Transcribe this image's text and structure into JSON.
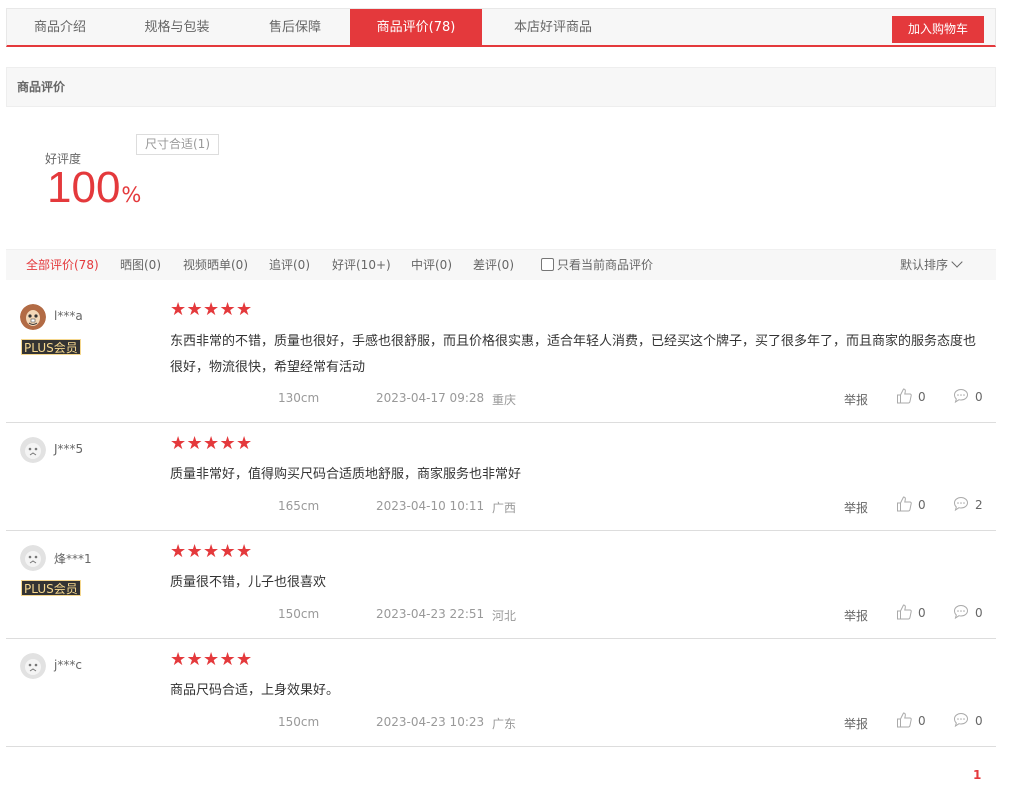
{
  "tabs": [
    {
      "label": "商品介绍"
    },
    {
      "label": "规格与包装"
    },
    {
      "label": "售后保障"
    },
    {
      "label": "商品评价(78)"
    },
    {
      "label": "本店好评商品"
    }
  ],
  "cart_button": "加入购物车",
  "section_title": "商品评价",
  "rating": {
    "label": "好评度",
    "value": "100",
    "unit": "%",
    "tag": "尺寸合适(1)"
  },
  "filters": [
    {
      "label": "全部评价(78)"
    },
    {
      "label": "晒图(0)"
    },
    {
      "label": "视频晒单(0)"
    },
    {
      "label": "追评(0)"
    },
    {
      "label": "好评(10+)"
    },
    {
      "label": "中评(0)"
    },
    {
      "label": "差评(0)"
    }
  ],
  "only_current_label": "只看当前商品评价",
  "sort_label": "默认排序",
  "report_label": "举报",
  "plus_label": "PLUS会员",
  "reviews": [
    {
      "user": "l***a",
      "content": "东西非常的不错，质量也很好，手感也很舒服，而且价格很实惠，适合年轻人消费，已经买这个牌子，买了很多年了，而且商家的服务态度也很好，物流很快，希望经常有活动",
      "size": "130cm",
      "time": "2023-04-17 09:28",
      "location": "重庆",
      "likes": "0",
      "comments": "0",
      "stars": 5,
      "plus": true
    },
    {
      "user": "J***5",
      "content": "质量非常好，值得购买尺码合适质地舒服，商家服务也非常好",
      "size": "165cm",
      "time": "2023-04-10 10:11",
      "location": "广西",
      "likes": "0",
      "comments": "2",
      "stars": 5,
      "plus": false
    },
    {
      "user": "烽***1",
      "content": "质量很不错，儿子也很喜欢",
      "size": "150cm",
      "time": "2023-04-23 22:51",
      "location": "河北",
      "likes": "0",
      "comments": "0",
      "stars": 5,
      "plus": true
    },
    {
      "user": "j***c",
      "content": "商品尺码合适，上身效果好。",
      "size": "150cm",
      "time": "2023-04-23 10:23",
      "location": "广东",
      "likes": "0",
      "comments": "0",
      "stars": 5,
      "plus": false
    }
  ],
  "pager": {
    "current": "1"
  },
  "colors": {
    "accent": "#e4393c",
    "plus_bg": "#333333",
    "plus_text": "#f5d78e"
  }
}
